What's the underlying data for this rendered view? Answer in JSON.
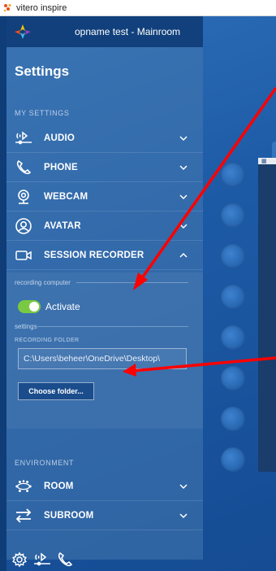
{
  "window": {
    "title": "vitero inspire"
  },
  "room": {
    "title": "opname test - Mainroom"
  },
  "settings": {
    "title": "Settings",
    "my_settings_label": "MY SETTINGS",
    "items": [
      {
        "label": "AUDIO",
        "icon": "audio-icon",
        "expanded": false
      },
      {
        "label": "PHONE",
        "icon": "phone-icon",
        "expanded": false
      },
      {
        "label": "WEBCAM",
        "icon": "webcam-icon",
        "expanded": false
      },
      {
        "label": "AVATAR",
        "icon": "avatar-icon",
        "expanded": false
      },
      {
        "label": "SESSION RECORDER",
        "icon": "session-recorder-icon",
        "expanded": true
      }
    ],
    "recorder": {
      "recording_computer_label": "recording computer",
      "activate_label": "Activate",
      "activate_on": true,
      "settings_label": "settings",
      "folder_label": "RECORDING FOLDER",
      "folder_value": "C:\\Users\\beheer\\OneDrive\\Desktop\\",
      "choose_button": "Choose folder..."
    },
    "environment_label": "ENVIRONMENT",
    "env_items": [
      {
        "label": "ROOM",
        "icon": "room-icon",
        "expanded": false
      },
      {
        "label": "SUBROOM",
        "icon": "subroom-icon",
        "expanded": false
      }
    ]
  },
  "colors": {
    "toggle_on": "#7ac943",
    "annotation_arrow": "#ff0000",
    "panel_background": "#11407c"
  },
  "bottom_bar": {
    "icons": [
      "settings-icon",
      "audio-icon",
      "phone-icon"
    ]
  }
}
